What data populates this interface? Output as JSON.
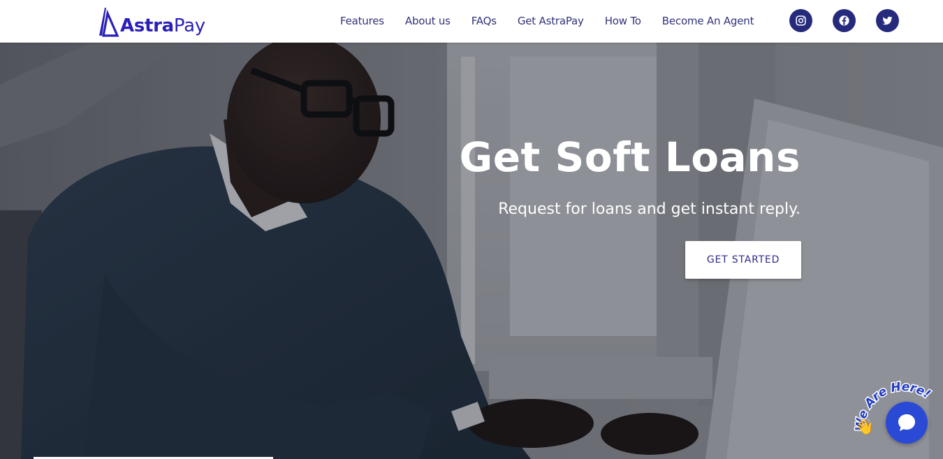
{
  "brand": {
    "name_bold": "Astra",
    "name_light": "Pay",
    "color": "#2a1fb8"
  },
  "nav": {
    "items": [
      {
        "label": "Features"
      },
      {
        "label": "About us"
      },
      {
        "label": "FAQs"
      },
      {
        "label": "Get AstraPay"
      },
      {
        "label": "How To"
      },
      {
        "label": "Become An Agent"
      }
    ],
    "social": [
      {
        "icon": "instagram-icon"
      },
      {
        "icon": "facebook-icon"
      },
      {
        "icon": "twitter-icon"
      }
    ],
    "social_color": "#262a7d"
  },
  "hero": {
    "title": "Get Soft Loans",
    "subtitle": "Request for loans and get instant reply.",
    "cta_label": "GET STARTED"
  },
  "chat": {
    "badge_text": "We Are Here!",
    "button_color": "#2a4ad6"
  }
}
